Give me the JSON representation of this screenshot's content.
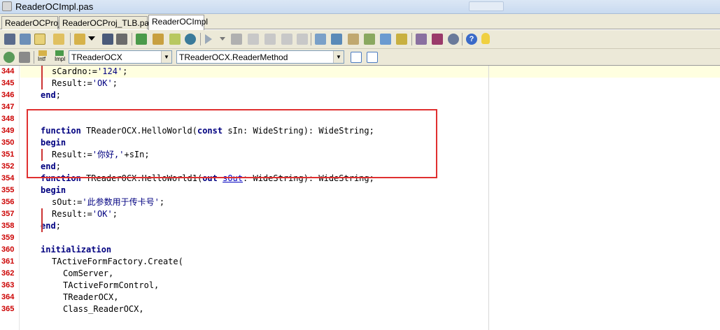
{
  "window": {
    "title": "ReaderOCImpl.pas"
  },
  "tabs": [
    {
      "label": "ReaderOCProj"
    },
    {
      "label": "ReaderOCProj_TLB.pas*"
    },
    {
      "label": "ReaderOCImpl"
    }
  ],
  "toolbar2": {
    "intf_label": "Intf",
    "impl_label": "Impl",
    "class_combo": "TReaderOCX",
    "method_combo": "TReaderOCX.ReaderMethod"
  },
  "editor": {
    "lines": [
      {
        "num": "344",
        "text": "sCardno:='124';"
      },
      {
        "num": "345",
        "text": "Result:='OK';"
      },
      {
        "num": "346",
        "text": "end;"
      },
      {
        "num": "347",
        "text": ""
      },
      {
        "num": "348",
        "text": ""
      },
      {
        "num": "349",
        "text": "function TReaderOCX.HelloWorld(const sIn: WideString): WideString;"
      },
      {
        "num": "350",
        "text": "begin"
      },
      {
        "num": "351",
        "text": "Result:='你好,'+sIn;"
      },
      {
        "num": "352",
        "text": "end;"
      },
      {
        "num": "354",
        "text": "function TReaderOCX.HelloWorld1(out sOut: WideString): WideString;"
      },
      {
        "num": "355",
        "text": "begin"
      },
      {
        "num": "356",
        "text": "sOut:='此参数用于传卡号';"
      },
      {
        "num": "357",
        "text": "Result:='OK';"
      },
      {
        "num": "358",
        "text": "end;"
      },
      {
        "num": "359",
        "text": ""
      },
      {
        "num": "360",
        "text": "initialization"
      },
      {
        "num": "361",
        "text": "TActiveFormFactory.Create("
      },
      {
        "num": "362",
        "text": "ComServer,"
      },
      {
        "num": "363",
        "text": "TActiveFormControl,"
      },
      {
        "num": "364",
        "text": "TReaderOCX,"
      },
      {
        "num": "365",
        "text": "Class_ReaderOCX,"
      }
    ]
  },
  "colors": {
    "line_number": "#cc0000",
    "keyword": "#000080",
    "highlight_box": "#e03030"
  }
}
